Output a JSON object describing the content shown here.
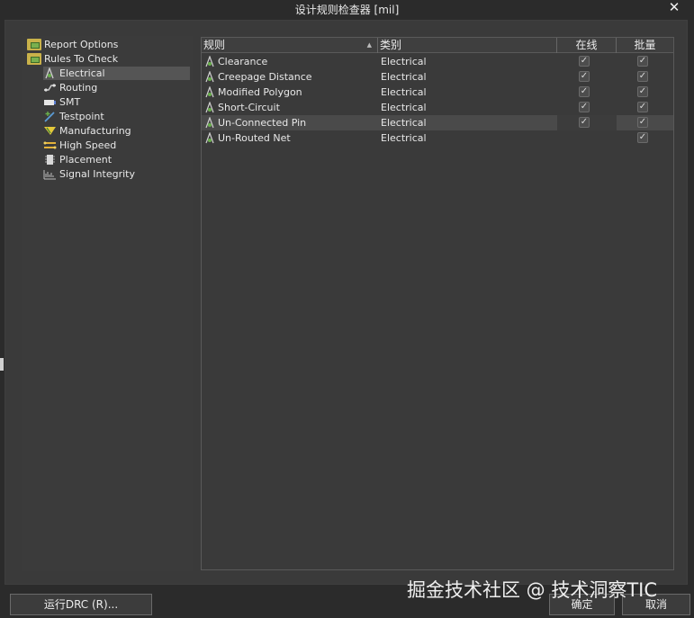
{
  "window": {
    "title": "设计规则检查器 [mil]",
    "close_glyph": "✕"
  },
  "tree": {
    "items": [
      {
        "label": "Report Options",
        "icon": "folder-check-icon"
      },
      {
        "label": "Rules To Check",
        "icon": "folder-check-icon"
      },
      {
        "label": "Electrical",
        "icon": "electrical-icon"
      },
      {
        "label": "Routing",
        "icon": "routing-icon"
      },
      {
        "label": "SMT",
        "icon": "smt-icon"
      },
      {
        "label": "Testpoint",
        "icon": "testpoint-icon"
      },
      {
        "label": "Manufacturing",
        "icon": "manufacturing-icon"
      },
      {
        "label": "High Speed",
        "icon": "high-speed-icon"
      },
      {
        "label": "Placement",
        "icon": "placement-icon"
      },
      {
        "label": "Signal Integrity",
        "icon": "signal-integrity-icon"
      }
    ],
    "selected": "Electrical"
  },
  "grid": {
    "columns": {
      "rule": "规则",
      "category": "类别",
      "online": "在线",
      "batch": "批量"
    },
    "sort_glyph": "▲",
    "rows": [
      {
        "rule": "Clearance",
        "category": "Electrical",
        "online": true,
        "batch": true
      },
      {
        "rule": "Creepage Distance",
        "category": "Electrical",
        "online": true,
        "batch": true
      },
      {
        "rule": "Modified Polygon",
        "category": "Electrical",
        "online": true,
        "batch": true
      },
      {
        "rule": "Short-Circuit",
        "category": "Electrical",
        "online": true,
        "batch": true
      },
      {
        "rule": "Un-Connected Pin",
        "category": "Electrical",
        "online": true,
        "batch": true
      },
      {
        "rule": "Un-Routed Net",
        "category": "Electrical",
        "online": false,
        "batch": true
      }
    ],
    "selected_row": "Un-Connected Pin",
    "check_glyph": "✓"
  },
  "buttons": {
    "run_drc": "运行DRC (R)...",
    "ok": "确定",
    "cancel": "取消"
  },
  "watermark": "掘金技术社区 @ 技术洞察TIC"
}
